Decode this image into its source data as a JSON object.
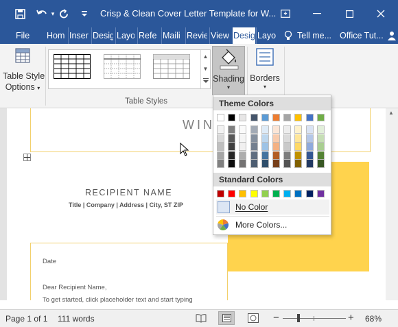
{
  "titlebar": {
    "title": "Crisp & Clean Cover Letter Template for W...",
    "help_glyph": "?"
  },
  "tabs": {
    "file": "File",
    "home": "Hom",
    "insert": "Inser",
    "design": "Desig",
    "layout": "Layo",
    "references": "Refe",
    "mailings": "Maili",
    "review": "Revie",
    "view": "View",
    "table_design": "Desig",
    "table_layout": "Layo",
    "tell_me": "Tell me...",
    "account": "Office Tut..."
  },
  "ribbon": {
    "table_style_options": "Table Style Options",
    "table_style_options_line1": "Table Style",
    "table_style_options_line2": "Options",
    "shading": "Shading",
    "borders": "Borders",
    "group_table_styles": "Table Styles"
  },
  "document": {
    "name_fragment": "WIN",
    "recipient_name": "RECIPIENT NAME",
    "recipient_details": "Title | Company | Address | City, ST ZIP",
    "date": "Date",
    "greeting": "Dear Recipient Name,",
    "body_fragment": "To get started, click placeholder text and start typing"
  },
  "shading_menu": {
    "theme_colors_header": "Theme Colors",
    "standard_colors_header": "Standard Colors",
    "no_color": "No Color",
    "more_colors": "More Colors...",
    "theme_top_row": [
      "#ffffff",
      "#000000",
      "#e7e6e6",
      "#44546a",
      "#5b9bd5",
      "#ed7d31",
      "#a5a5a5",
      "#ffc000",
      "#4472c4",
      "#70ad47"
    ],
    "standard_colors": [
      "#c00000",
      "#ff0000",
      "#ffc000",
      "#ffff00",
      "#92d050",
      "#00b050",
      "#00b0f0",
      "#0070c0",
      "#002060",
      "#7030a0"
    ]
  },
  "statusbar": {
    "page": "Page 1 of 1",
    "words": "111 words",
    "zoom_minus": "−",
    "zoom_plus": "+",
    "zoom_level": "68%"
  },
  "colors": {
    "accent": "#2b579a",
    "highlight_block": "#ffd34d",
    "section_border": "#f2d06b"
  }
}
